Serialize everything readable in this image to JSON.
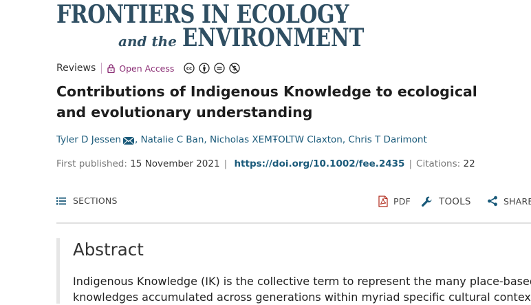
{
  "journal": {
    "name_line1": "FRONTIERS IN ECOLOGY",
    "name_and": "and the",
    "name_line2": "ENVIRONMENT"
  },
  "article": {
    "type": "Reviews",
    "access": "Open Access",
    "license_icons": [
      "cc-icon",
      "attribution-icon",
      "no-derivatives-icon",
      "non-commercial-icon"
    ],
    "title": "Contributions of Indigenous Knowledge to ecological and evolutionary understanding",
    "authors": [
      "Tyler D Jessen",
      "Natalie C Ban",
      "Nicholas XEMŦOLTW Claxton",
      "Chris T Darimont"
    ],
    "first_published_label": "First published:",
    "first_published": "15 November 2021",
    "doi": "https://doi.org/10.1002/fee.2435",
    "citations_label": "Citations:",
    "citations": "22"
  },
  "toolbar": {
    "sections": "SECTIONS",
    "pdf": "PDF",
    "tools": "TOOLS",
    "share": "SHARE"
  },
  "abstract": {
    "heading": "Abstract",
    "line1": "Indigenous Knowledge (IK) is the collective term to represent the many place-based",
    "line2": "knowledges accumulated across generations within myriad specific cultural contexts"
  },
  "colors": {
    "journal": "#2f4f63",
    "link": "#1a5a7a",
    "open_access": "#8b2e75"
  }
}
